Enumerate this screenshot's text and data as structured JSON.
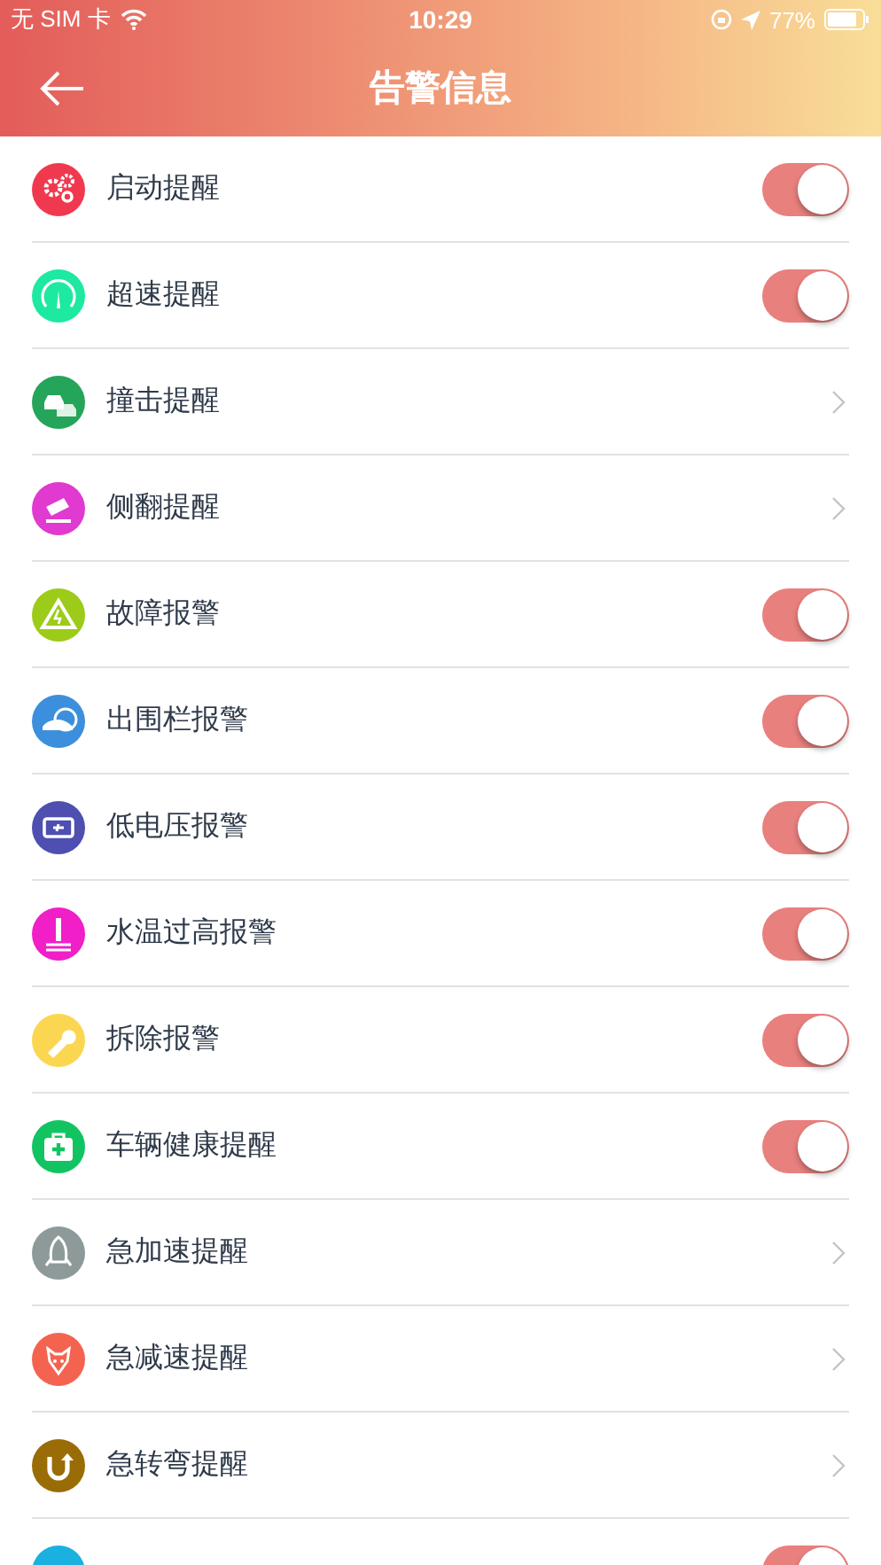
{
  "status_bar": {
    "carrier": "无 SIM 卡",
    "time": "10:29",
    "battery": "77%"
  },
  "nav": {
    "title": "告警信息"
  },
  "items": [
    {
      "label": "启动提醒",
      "kind": "toggle",
      "on": true,
      "color": "#f0394f"
    },
    {
      "label": "超速提醒",
      "kind": "toggle",
      "on": true,
      "color": "#1de9a0"
    },
    {
      "label": "撞击提醒",
      "kind": "link",
      "color": "#25a55a"
    },
    {
      "label": "侧翻提醒",
      "kind": "link",
      "color": "#e03ad0"
    },
    {
      "label": "故障报警",
      "kind": "toggle",
      "on": true,
      "color": "#9ccb19"
    },
    {
      "label": "出围栏报警",
      "kind": "toggle",
      "on": true,
      "color": "#3c8fdc"
    },
    {
      "label": "低电压报警",
      "kind": "toggle",
      "on": true,
      "color": "#4e4fb0"
    },
    {
      "label": "水温过高报警",
      "kind": "toggle",
      "on": true,
      "color": "#f01fc8"
    },
    {
      "label": "拆除报警",
      "kind": "toggle",
      "on": true,
      "color": "#fbd650"
    },
    {
      "label": "车辆健康提醒",
      "kind": "toggle",
      "on": true,
      "color": "#12c461"
    },
    {
      "label": "急加速提醒",
      "kind": "link",
      "color": "#8e9a9a"
    },
    {
      "label": "急减速提醒",
      "kind": "link",
      "color": "#f46350"
    },
    {
      "label": "急转弯提醒",
      "kind": "link",
      "color": "#9a6c06"
    },
    {
      "kind": "toggle",
      "on": true,
      "color": "#1ab0e0"
    }
  ]
}
